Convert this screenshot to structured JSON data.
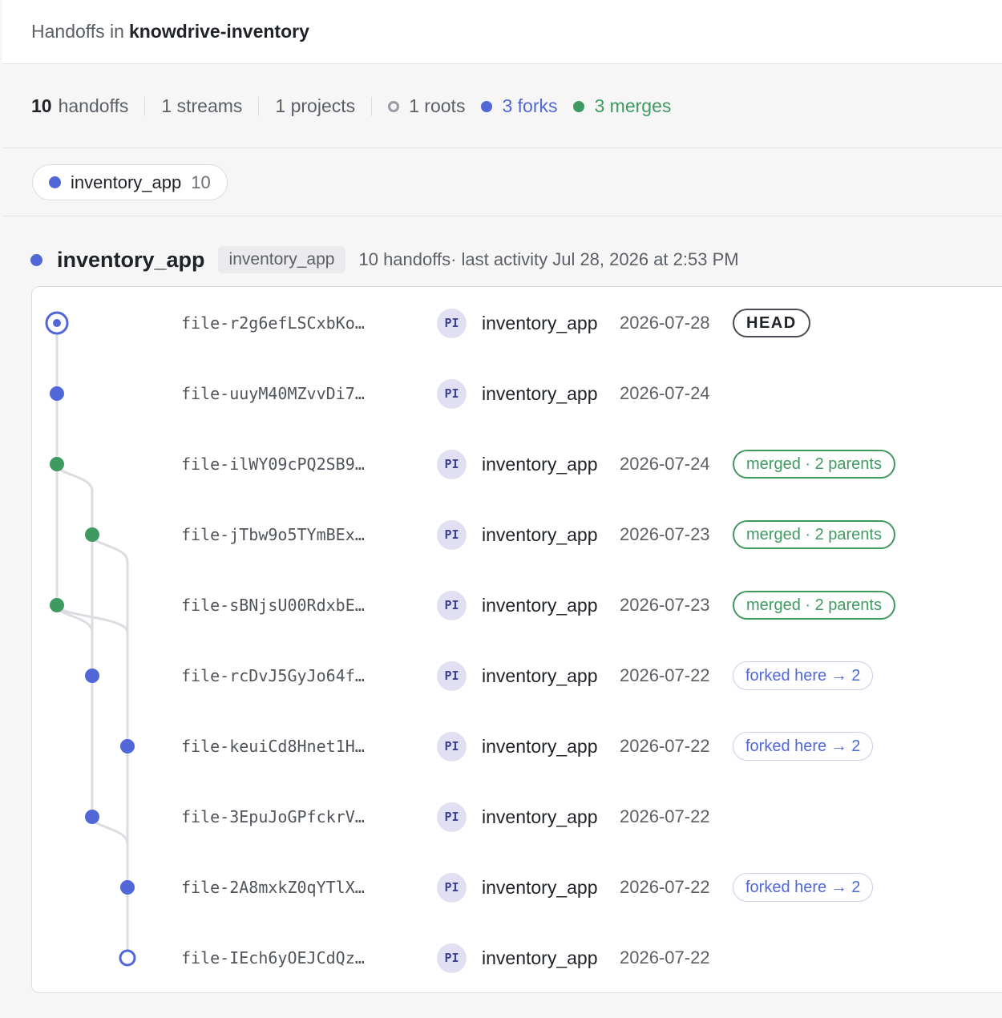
{
  "header": {
    "prefix": "Handoffs in",
    "repo": "knowdrive-inventory"
  },
  "stats": {
    "handoffs_num": "10",
    "handoffs_label": "handoffs",
    "streams": "1 streams",
    "projects": "1 projects",
    "roots": "1 roots",
    "forks": "3 forks",
    "merges": "3 merges"
  },
  "filter_chip": {
    "label": "inventory_app",
    "count": "10"
  },
  "stream": {
    "title": "inventory_app",
    "tag": "inventory_app",
    "count": "10 handoffs",
    "activity": "· last activity Jul 28, 2026 at 2:53 PM"
  },
  "colors": {
    "accent": "#5167d8",
    "merge": "#3f9a62"
  },
  "handoffs": [
    {
      "file": "file-r2g6efLSCxbKo…",
      "avatar": "PI",
      "author": "inventory_app",
      "date": "2026-07-28",
      "badge": "HEAD",
      "badge_type": "head"
    },
    {
      "file": "file-uuyM40MZvvDi7…",
      "avatar": "PI",
      "author": "inventory_app",
      "date": "2026-07-24",
      "badge": "",
      "badge_type": ""
    },
    {
      "file": "file-ilWY09cPQ2SB9…",
      "avatar": "PI",
      "author": "inventory_app",
      "date": "2026-07-24",
      "badge": "merged · 2 parents",
      "badge_type": "merged"
    },
    {
      "file": "file-jTbw9o5TYmBEx…",
      "avatar": "PI",
      "author": "inventory_app",
      "date": "2026-07-23",
      "badge": "merged · 2 parents",
      "badge_type": "merged"
    },
    {
      "file": "file-sBNjsU00RdxbE…",
      "avatar": "PI",
      "author": "inventory_app",
      "date": "2026-07-23",
      "badge": "merged · 2 parents",
      "badge_type": "merged"
    },
    {
      "file": "file-rcDvJ5GyJo64f…",
      "avatar": "PI",
      "author": "inventory_app",
      "date": "2026-07-22",
      "badge": "forked here → 2",
      "badge_type": "forked"
    },
    {
      "file": "file-keuiCd8Hnet1H…",
      "avatar": "PI",
      "author": "inventory_app",
      "date": "2026-07-22",
      "badge": "forked here → 2",
      "badge_type": "forked"
    },
    {
      "file": "file-3EpuJoGPfckrV…",
      "avatar": "PI",
      "author": "inventory_app",
      "date": "2026-07-22",
      "badge": "",
      "badge_type": ""
    },
    {
      "file": "file-2A8mxkZ0qYTlX…",
      "avatar": "PI",
      "author": "inventory_app",
      "date": "2026-07-22",
      "badge": "forked here → 2",
      "badge_type": "forked"
    },
    {
      "file": "file-IEch6yOEJCdQz…",
      "avatar": "PI",
      "author": "inventory_app",
      "date": "2026-07-22",
      "badge": "",
      "badge_type": ""
    }
  ]
}
